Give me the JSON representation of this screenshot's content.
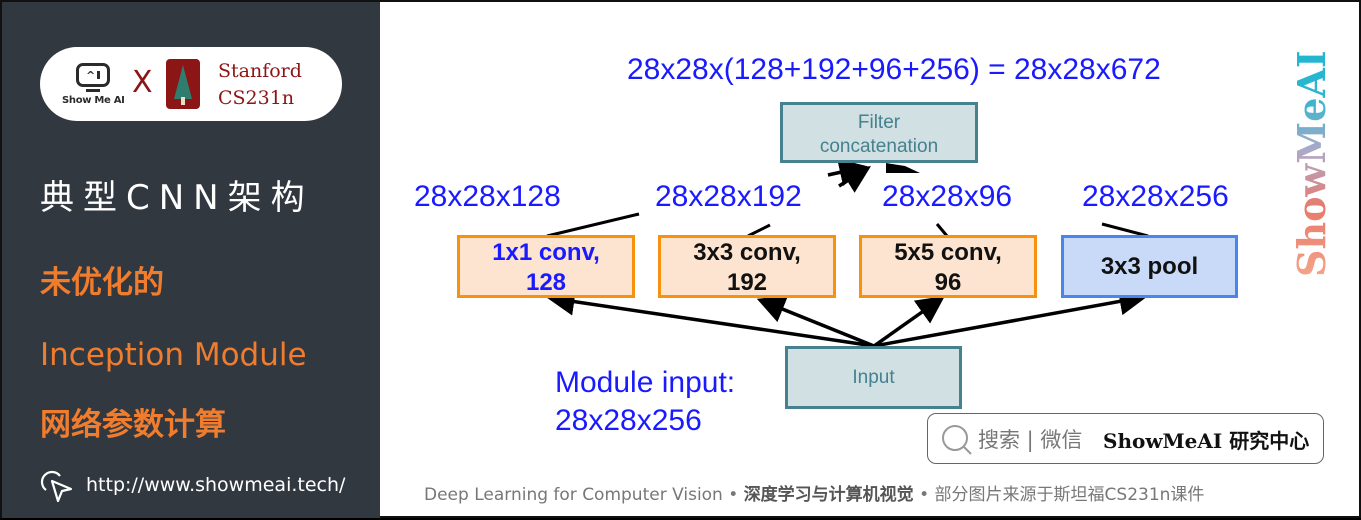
{
  "sidebar": {
    "logo_text": "Show Me AI",
    "logo_eye": "^",
    "x_mark": "X",
    "partner_line1": "Stanford",
    "partner_line2": "CS231n",
    "title": "典型CNN架构",
    "subtitle1": "未优化的",
    "subtitle2": "Inception Module",
    "subtitle3": "网络参数计算",
    "url": "http://www.showmeai.tech/",
    "accent_color": "#f07c2d",
    "bg_color": "#323840"
  },
  "diagram": {
    "formula": "28x28x(128+192+96+256) = 28x28x672",
    "concat_box": "Filter concatenation",
    "output_labels": [
      "28x28x128",
      "28x28x192",
      "28x28x96",
      "28x28x256"
    ],
    "branches": [
      {
        "line1": "1x1 conv,",
        "line2": "128",
        "type": "conv",
        "highlight": true
      },
      {
        "line1": "3x3 conv,",
        "line2": "192",
        "type": "conv",
        "highlight": false
      },
      {
        "line1": "5x5 conv,",
        "line2": "96",
        "type": "conv",
        "highlight": false
      },
      {
        "line1": "3x3 pool",
        "line2": "",
        "type": "pool",
        "highlight": false
      }
    ],
    "input_box": "Input",
    "module_input_line1": "Module input:",
    "module_input_line2": "28x28x256"
  },
  "search": {
    "icon": "search-icon",
    "hint": "搜索 | 微信",
    "brand": "ShowMeAI 研究中心"
  },
  "brand_vertical": "ShowMeAI",
  "footer": {
    "part1": "Deep Learning for Computer Vision",
    "sep": " • ",
    "part2": "深度学习与计算机视觉",
    "part3": "部分图片来源于斯坦福CS231n课件"
  }
}
